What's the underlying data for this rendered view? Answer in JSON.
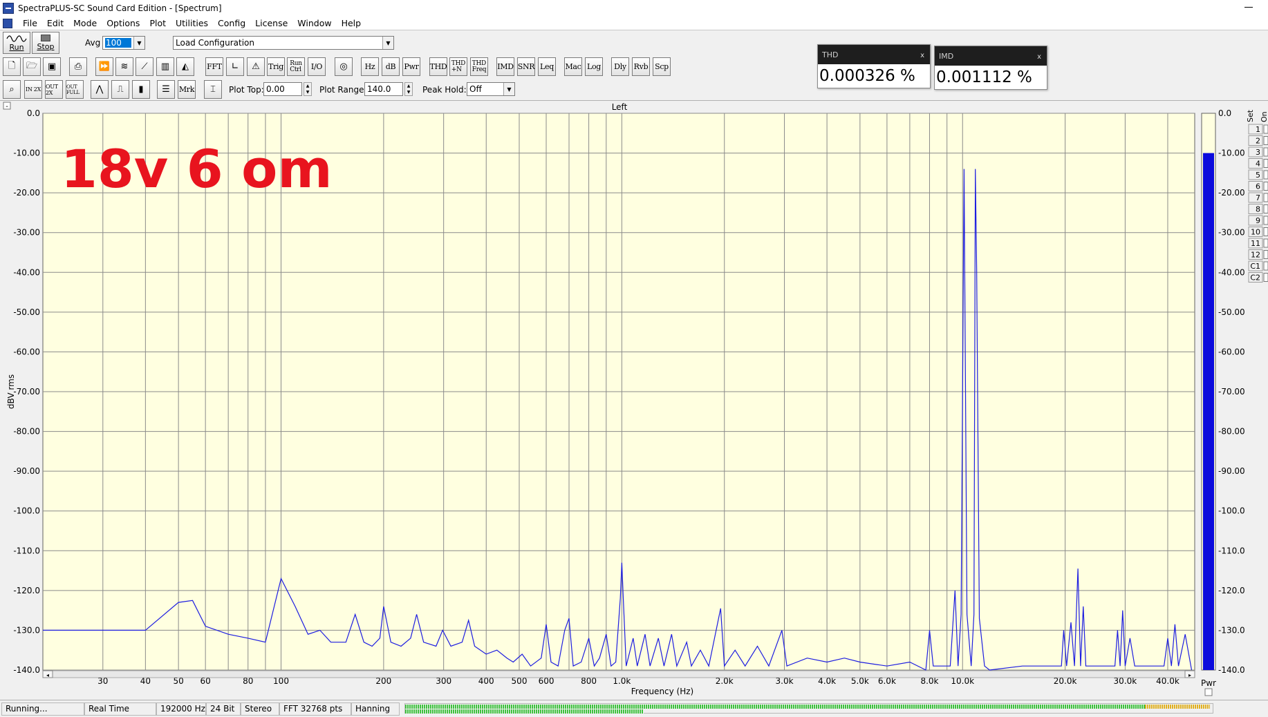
{
  "window": {
    "title": "SpectraPLUS-SC Sound Card Edition - [Spectrum]"
  },
  "menu": [
    "File",
    "Edit",
    "Mode",
    "Options",
    "Plot",
    "Utilities",
    "Config",
    "License",
    "Window",
    "Help"
  ],
  "toolbar1": {
    "run_label": "Run",
    "stop_label": "Stop",
    "avg_label": "Avg",
    "avg_value": "100",
    "config_value": "Load Configuration"
  },
  "toolbar2": {
    "fft": "FFT",
    "trig": "Trig",
    "run_ctrl": "Run\nCtrl",
    "io": "I/O",
    "hz": "Hz",
    "db": "dB",
    "pwr": "Pwr",
    "thd": "THD",
    "thdn": "THD\n+N",
    "thd_freq": "THD\nFreq",
    "imd": "IMD",
    "snr": "SNR",
    "leq": "Leq",
    "mac": "Mac",
    "log": "Log",
    "dly": "Dly",
    "rvb": "Rvb",
    "scp": "Scp"
  },
  "toolbar3": {
    "in2x": "IN 2X",
    "out2x": "OUT 2X",
    "outfull": "OUT FULL",
    "mrk": "Mrk",
    "plot_top_label": "Plot Top:",
    "plot_top_value": "0.00",
    "plot_range_label": "Plot Range:",
    "plot_range_value": "140.0",
    "peak_hold_label": "Peak Hold:",
    "peak_hold_value": "Off"
  },
  "readouts": {
    "thd": {
      "title": "THD",
      "close": "x",
      "value": "0.000326 %"
    },
    "imd": {
      "title": "IMD",
      "close": "x",
      "value": "0.001112 %"
    }
  },
  "plot": {
    "channel_title": "Left",
    "annotation": "18v 6 om",
    "collapse_glyph": "-",
    "pwr_label": "Pwr",
    "set_label": "Set",
    "on_label": "On",
    "set_items": [
      "1",
      "2",
      "3",
      "4",
      "5",
      "6",
      "7",
      "8",
      "9",
      "10",
      "11",
      "12",
      "C1",
      "C2"
    ],
    "colors": {
      "background": "#ffffe0",
      "grid": "#8a8a8a",
      "trace": "#1c1ce0",
      "meter": "#0b0bdc",
      "annotation": "#e8141e"
    }
  },
  "chart_data": {
    "type": "line",
    "title": "Left",
    "xlabel": "Frequency (Hz)",
    "ylabel": "dBV rms",
    "xscale": "log",
    "xlim": [
      20,
      48000
    ],
    "ylim": [
      -140,
      0
    ],
    "x_ticks": [
      {
        "v": 30,
        "label": "30"
      },
      {
        "v": 40,
        "label": "40"
      },
      {
        "v": 50,
        "label": "50"
      },
      {
        "v": 60,
        "label": "60"
      },
      {
        "v": 80,
        "label": "80"
      },
      {
        "v": 100,
        "label": "100"
      },
      {
        "v": 200,
        "label": "200"
      },
      {
        "v": 300,
        "label": "300"
      },
      {
        "v": 400,
        "label": "400"
      },
      {
        "v": 500,
        "label": "500"
      },
      {
        "v": 600,
        "label": "600"
      },
      {
        "v": 800,
        "label": "800"
      },
      {
        "v": 1000,
        "label": "1.0k"
      },
      {
        "v": 2000,
        "label": "2.0k"
      },
      {
        "v": 3000,
        "label": "3.0k"
      },
      {
        "v": 4000,
        "label": "4.0k"
      },
      {
        "v": 5000,
        "label": "5.0k"
      },
      {
        "v": 6000,
        "label": "6.0k"
      },
      {
        "v": 8000,
        "label": "8.0k"
      },
      {
        "v": 10000,
        "label": "10.0k"
      },
      {
        "v": 20000,
        "label": "20.0k"
      },
      {
        "v": 30000,
        "label": "30.0k"
      },
      {
        "v": 40000,
        "label": "40.0k"
      }
    ],
    "minor_gridlines": [
      70,
      90,
      700,
      900,
      7000,
      9000
    ],
    "y_ticks_left": [
      "0.0",
      "-10.00",
      "-20.00",
      "-30.00",
      "-40.00",
      "-50.00",
      "-60.00",
      "-70.00",
      "-80.00",
      "-90.00",
      "-100.0",
      "-110.0",
      "-120.0",
      "-130.0",
      "-140.0"
    ],
    "y_ticks_right": [
      "0.0",
      "-10.00",
      "-20.00",
      "-30.00",
      "-40.00",
      "-50.00",
      "-60.00",
      "-70.00",
      "-80.00",
      "-90.00",
      "-100.0",
      "-110.0",
      "-120.0",
      "-130.0",
      "-140.0"
    ],
    "grid": true,
    "power_level_db": -10,
    "series": [
      {
        "points": [
          [
            20,
            -130
          ],
          [
            30,
            -130
          ],
          [
            40,
            -130
          ],
          [
            50,
            -123
          ],
          [
            55,
            -122.5
          ],
          [
            60,
            -129
          ],
          [
            70,
            -131
          ],
          [
            80,
            -132
          ],
          [
            90,
            -133
          ],
          [
            100,
            -117
          ],
          [
            110,
            -124
          ],
          [
            120,
            -131
          ],
          [
            130,
            -130
          ],
          [
            140,
            -133
          ],
          [
            155,
            -133
          ],
          [
            165,
            -126
          ],
          [
            175,
            -133
          ],
          [
            185,
            -134
          ],
          [
            195,
            -132
          ],
          [
            200,
            -124
          ],
          [
            210,
            -133
          ],
          [
            225,
            -134
          ],
          [
            240,
            -132
          ],
          [
            250,
            -126
          ],
          [
            262,
            -133
          ],
          [
            285,
            -134
          ],
          [
            298,
            -130
          ],
          [
            315,
            -134
          ],
          [
            340,
            -133
          ],
          [
            355,
            -127.5
          ],
          [
            370,
            -134
          ],
          [
            400,
            -136
          ],
          [
            430,
            -135
          ],
          [
            460,
            -137
          ],
          [
            480,
            -138
          ],
          [
            510,
            -136
          ],
          [
            540,
            -139
          ],
          [
            580,
            -137
          ],
          [
            600,
            -128.5
          ],
          [
            620,
            -138
          ],
          [
            650,
            -139
          ],
          [
            680,
            -130
          ],
          [
            700,
            -127
          ],
          [
            720,
            -139
          ],
          [
            760,
            -138
          ],
          [
            800,
            -132
          ],
          [
            830,
            -139
          ],
          [
            860,
            -137
          ],
          [
            900,
            -131
          ],
          [
            930,
            -139
          ],
          [
            960,
            -138
          ],
          [
            990,
            -122
          ],
          [
            1000,
            -113
          ],
          [
            1010,
            -122
          ],
          [
            1030,
            -139
          ],
          [
            1080,
            -132
          ],
          [
            1110,
            -139
          ],
          [
            1170,
            -131
          ],
          [
            1210,
            -139
          ],
          [
            1280,
            -132
          ],
          [
            1330,
            -139
          ],
          [
            1400,
            -131
          ],
          [
            1450,
            -139
          ],
          [
            1550,
            -133
          ],
          [
            1600,
            -139
          ],
          [
            1700,
            -135
          ],
          [
            1800,
            -139
          ],
          [
            1950,
            -124.5
          ],
          [
            2000,
            -139
          ],
          [
            2150,
            -135
          ],
          [
            2300,
            -139
          ],
          [
            2500,
            -134
          ],
          [
            2700,
            -139
          ],
          [
            2950,
            -130
          ],
          [
            3050,
            -139
          ],
          [
            3500,
            -137
          ],
          [
            4000,
            -138
          ],
          [
            4500,
            -137
          ],
          [
            5000,
            -138
          ],
          [
            6000,
            -139
          ],
          [
            7000,
            -138
          ],
          [
            7800,
            -140
          ],
          [
            8000,
            -130
          ],
          [
            8200,
            -139
          ],
          [
            9200,
            -139
          ],
          [
            9500,
            -120
          ],
          [
            9700,
            -139
          ],
          [
            9900,
            -126
          ],
          [
            10100,
            -14
          ],
          [
            10300,
            -126
          ],
          [
            10600,
            -139
          ],
          [
            10800,
            -126
          ],
          [
            10900,
            -14
          ],
          [
            11000,
            -39
          ],
          [
            11200,
            -127
          ],
          [
            11600,
            -139
          ],
          [
            12000,
            -140
          ],
          [
            15000,
            -139
          ],
          [
            19500,
            -139
          ],
          [
            19800,
            -130
          ],
          [
            20200,
            -139
          ],
          [
            20800,
            -128
          ],
          [
            21300,
            -139
          ],
          [
            21800,
            -114.5
          ],
          [
            22200,
            -139
          ],
          [
            22600,
            -124
          ],
          [
            23000,
            -139
          ],
          [
            28000,
            -139
          ],
          [
            28500,
            -130
          ],
          [
            29000,
            -139
          ],
          [
            29500,
            -125
          ],
          [
            30000,
            -139
          ],
          [
            31000,
            -132
          ],
          [
            32000,
            -139
          ],
          [
            39000,
            -139
          ],
          [
            40000,
            -132
          ],
          [
            41000,
            -139
          ],
          [
            42000,
            -128.5
          ],
          [
            43000,
            -139
          ],
          [
            45000,
            -131
          ],
          [
            47000,
            -140
          ]
        ]
      }
    ]
  },
  "status": {
    "state": "Running...",
    "mode": "Real Time",
    "rate": "192000 Hz",
    "bits": "24 Bit",
    "channels": "Stereo",
    "fft": "FFT 32768 pts",
    "window": "Hanning"
  }
}
